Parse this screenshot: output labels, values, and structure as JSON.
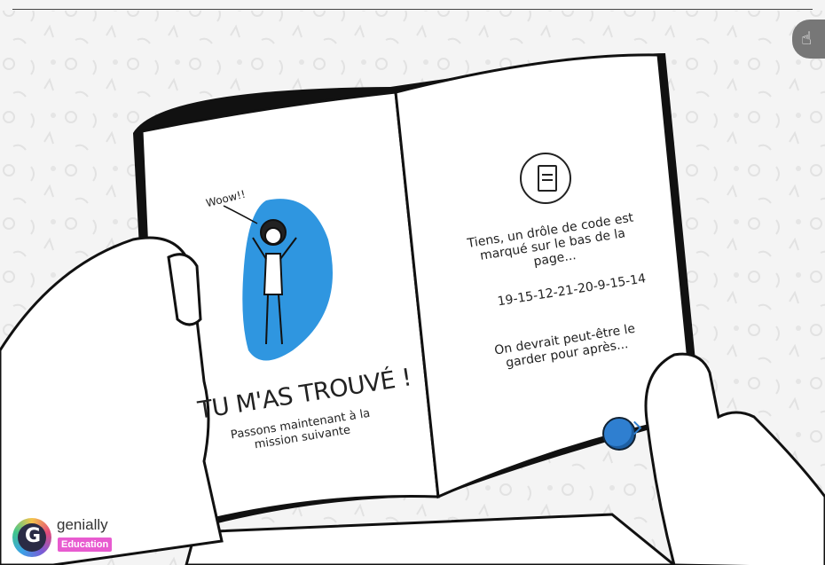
{
  "left_page": {
    "exclamation": "Woow!!",
    "title": "TU M'AS TROUVÉ !",
    "subtitle": "Passons maintenant à la mission suivante"
  },
  "right_page": {
    "note": "Tiens, un drôle de code est marqué sur le bas de la page...",
    "code": "19-15-12-21-20-9-15-14",
    "hint": "On devrait peut-être le garder pour après..."
  },
  "controls": {
    "touch_icon": "touch-pointer-icon",
    "next_button_icon": "next-arrow-icon",
    "document_icon": "document-icon"
  },
  "brand": {
    "name": "genially",
    "tag": "Education"
  },
  "colors": {
    "accent_blue": "#2f96e0",
    "brand_pink": "#e85bd0"
  }
}
